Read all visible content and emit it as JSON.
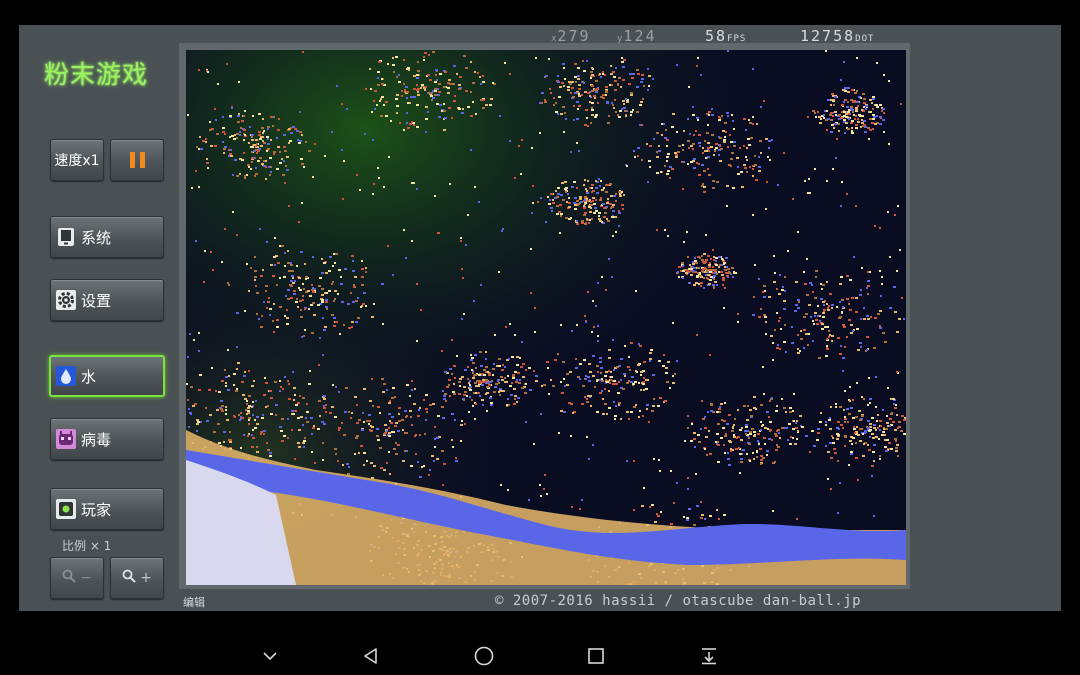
{
  "app": {
    "title": "粉末游戏"
  },
  "toolbar": {
    "speed_label": "速度x1",
    "pause_icon": "pause-icon",
    "system_label": "系统",
    "settings_label": "设置",
    "water_label": "水",
    "virus_label": "病毒",
    "player_label": "玩家",
    "scale_label": "比例 × 1",
    "zoom_out_label": "−",
    "zoom_in_label": "+"
  },
  "hud": {
    "x_label": "x",
    "x_value": "279",
    "y_label": "y",
    "y_value": "124",
    "fps_value": "58",
    "fps_unit": "FPS",
    "dot_value": "12758",
    "dot_unit": "DOT"
  },
  "footer": {
    "edit_label": "编辑",
    "copyright": "© 2007-2016 hassii / otascube dan-ball.jp"
  },
  "colors": {
    "accent_green": "#9cf35e",
    "pause_orange": "#f48a1f",
    "water_blue": "#5a66e8",
    "sand": "#e9b86a",
    "fire_red": "#d2543a"
  },
  "navbar": {
    "icons": [
      "chevron-down-icon",
      "back-icon",
      "home-icon",
      "recents-icon",
      "notification-pulldown-icon"
    ]
  }
}
